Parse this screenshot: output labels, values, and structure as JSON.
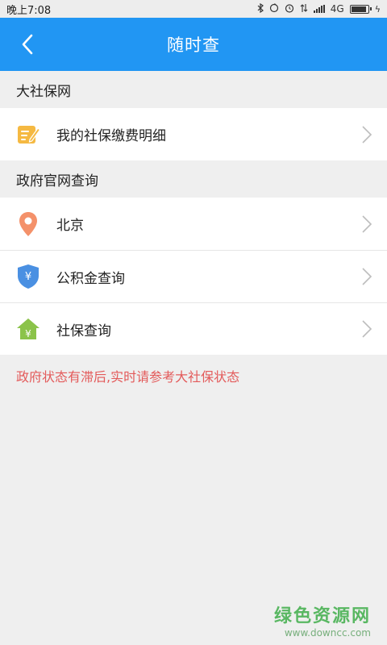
{
  "status_bar": {
    "time": "晚上7:08",
    "network": "4G",
    "battery_level": 0.9
  },
  "app_bar": {
    "title": "随时查"
  },
  "sections": [
    {
      "title": "大社保网",
      "items": [
        {
          "label": "我的社保缴费明细",
          "icon": "edit-note-icon",
          "color": "#f5b942"
        }
      ]
    },
    {
      "title": "政府官网查询",
      "items": [
        {
          "label": "北京",
          "icon": "location-pin-icon",
          "color": "#f4916a"
        },
        {
          "label": "公积金查询",
          "icon": "yuan-shield-icon",
          "color": "#4a90e2"
        },
        {
          "label": "社保查询",
          "icon": "yuan-house-icon",
          "color": "#8bc34a"
        }
      ]
    }
  ],
  "notice": "政府状态有滞后,实时请参考大社保状态",
  "watermark": {
    "title": "绿色资源网",
    "url": "www.downcc.com"
  },
  "colors": {
    "accent": "#2196f3",
    "notice": "#e35a5a",
    "background": "#efefef"
  }
}
